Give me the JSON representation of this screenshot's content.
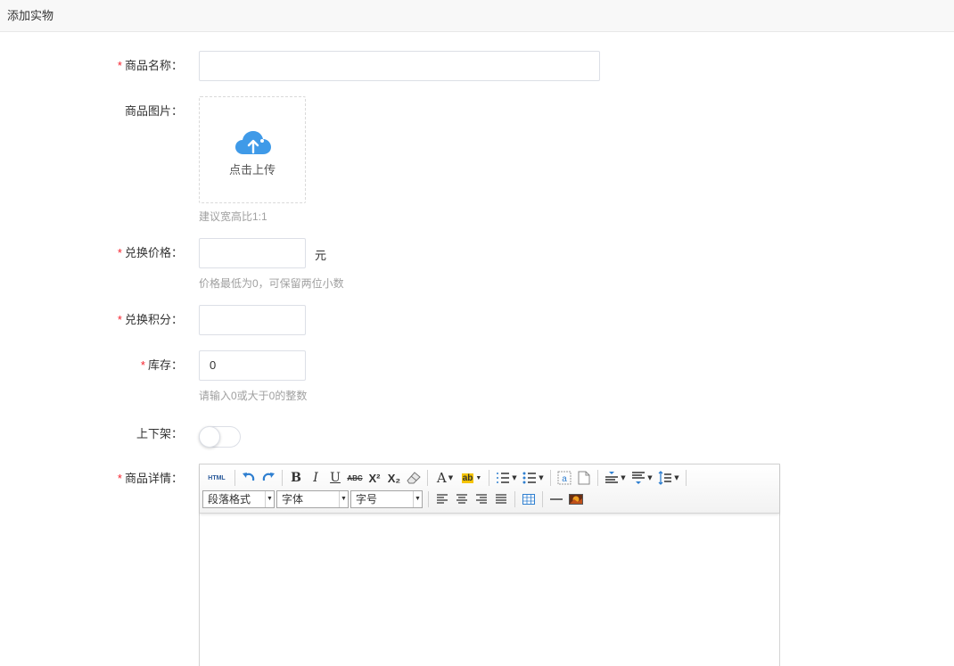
{
  "header": {
    "title": "添加实物"
  },
  "form": {
    "name": {
      "label": "商品名称",
      "required": true,
      "value": ""
    },
    "image": {
      "label": "商品图片",
      "required": false,
      "upload_text": "点击上传",
      "hint": "建议宽高比1:1"
    },
    "price": {
      "label": "兑换价格",
      "required": true,
      "value": "",
      "unit": "元",
      "hint": "价格最低为0，可保留两位小数"
    },
    "points": {
      "label": "兑换积分",
      "required": true,
      "value": ""
    },
    "stock": {
      "label": "库存",
      "required": true,
      "value": "0",
      "hint": "请输入0或大于0的整数"
    },
    "shelf": {
      "label": "上下架",
      "required": false,
      "on": false
    },
    "detail": {
      "label": "商品详情",
      "required": true
    }
  },
  "editor": {
    "row1": [
      "HTML",
      "undo",
      "redo",
      "B",
      "I",
      "U",
      "ABC",
      "X²",
      "X₂",
      "eraser",
      "A",
      "ab",
      "ol",
      "ul",
      "a",
      "page",
      "para-top",
      "para-bottom",
      "line-height"
    ],
    "paragraph_select": "段落格式",
    "font_select": "字体",
    "size_select": "字号"
  },
  "colors": {
    "required": "#f5222d",
    "hint": "#a0a0a0",
    "accent": "#3f9ae8"
  }
}
